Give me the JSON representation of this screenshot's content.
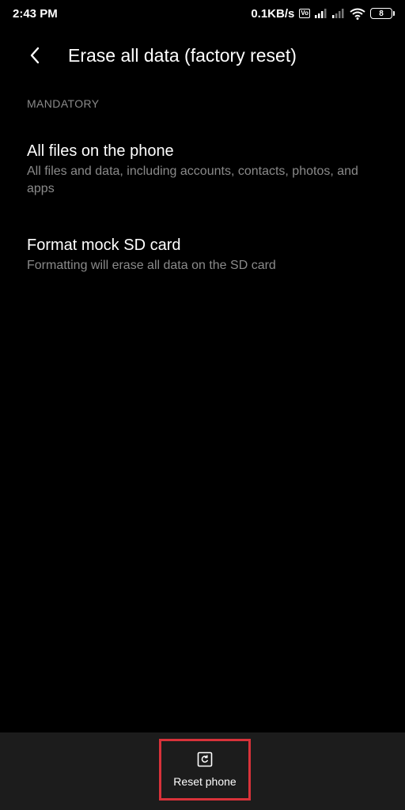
{
  "status_bar": {
    "time": "2:43 PM",
    "net_speed": "0.1KB/s",
    "volte_label": "Vo\nLTE",
    "battery_level": "8",
    "icons": [
      "volte-icon",
      "signal-icon",
      "signal-icon-2",
      "wifi-icon",
      "battery-icon"
    ]
  },
  "header": {
    "back_icon": "chevron-left-icon",
    "title": "Erase all data (factory reset)"
  },
  "section": {
    "label": "MANDATORY"
  },
  "items": [
    {
      "title": "All files on the phone",
      "subtitle": "All files and data, including accounts, contacts, photos, and apps"
    },
    {
      "title": "Format mock SD card",
      "subtitle": "Formatting will erase all data on the SD card"
    }
  ],
  "bottom_bar": {
    "reset_icon": "reset-phone-icon",
    "reset_label": "Reset phone",
    "highlight_color": "#d8323a"
  }
}
